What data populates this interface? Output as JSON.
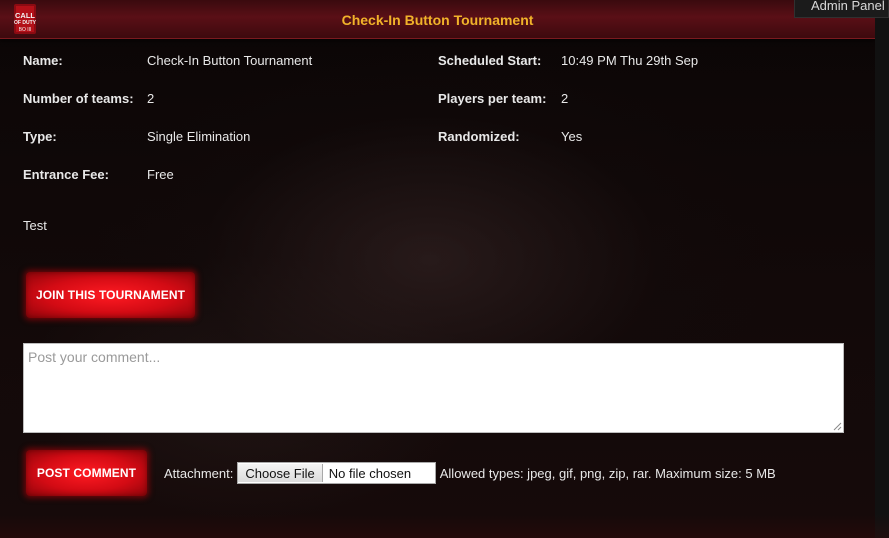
{
  "header": {
    "title": "Check-In Button Tournament",
    "logo_icon": "call-of-duty-logo",
    "admin_tab_label": "Admin Panel"
  },
  "details": {
    "name_label": "Name:",
    "name_value": "Check-In Button Tournament",
    "scheduled_label": "Scheduled Start:",
    "scheduled_value": "10:49 PM Thu 29th Sep",
    "teams_label": "Number of teams:",
    "teams_value": "2",
    "players_label": "Players per team:",
    "players_value": "2",
    "type_label": "Type:",
    "type_value": "Single Elimination",
    "randomized_label": "Randomized:",
    "randomized_value": "Yes",
    "fee_label": "Entrance Fee:",
    "fee_value": "Free",
    "description": "Test"
  },
  "actions": {
    "join_label": "JOIN THIS TOURNAMENT"
  },
  "comment": {
    "placeholder": "Post your comment...",
    "value": "",
    "post_label": "POST COMMENT",
    "attachment_label": "Attachment:",
    "choose_file_label": "Choose File",
    "file_status": "No file chosen",
    "allowed_types": "Allowed types: jpeg, gif, png, zip, rar. Maximum size: 5 MB"
  },
  "colors": {
    "title": "#f1b32a",
    "button_red": "#d30b14",
    "header_red": "#5a0f16"
  }
}
